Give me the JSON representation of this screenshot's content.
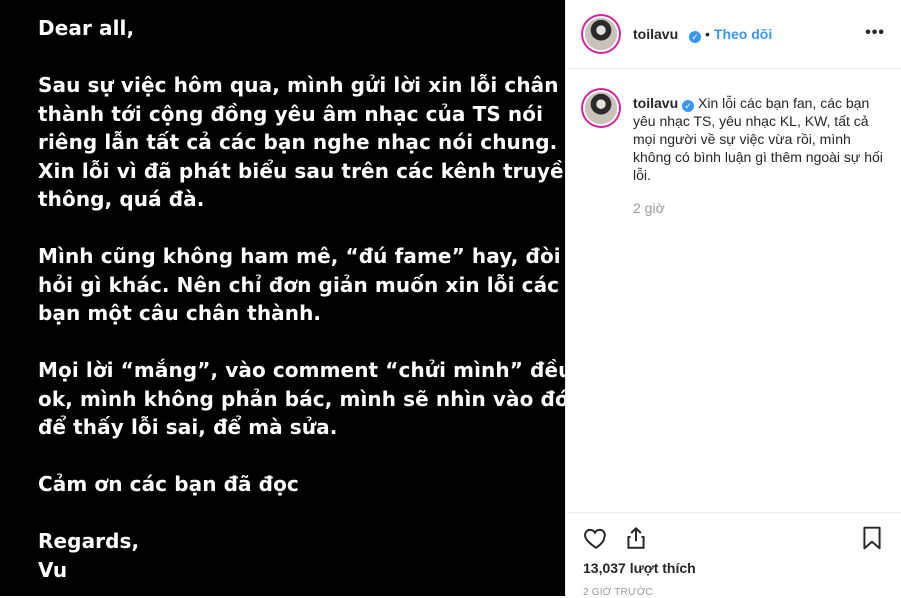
{
  "post_image": {
    "lines": [
      "Dear all,",
      "",
      "Sau sự việc hôm qua, mình gửi lời xin lỗi chân",
      "thành tới cộng đồng yêu âm nhạc của TS nói",
      "riêng lẫn tất cả các bạn nghe nhạc nói chung.",
      "Xin lỗi vì đã phát biểu sau trên các kênh truyền",
      "thông, quá đà.",
      "",
      "Mình cũng không ham mê, “đú fame” hay, đòi",
      "hỏi gì khác. Nên chỉ đơn giản muốn xin lỗi các",
      "bạn một câu chân thành.",
      "",
      "Mọi lời “mắng”, vào comment “chửi mình” đều",
      "ok, mình không phản bác, mình sẽ nhìn vào đó",
      "để thấy lỗi sai, để mà sửa.",
      "",
      "Cảm ơn các bạn đã đọc",
      "",
      "Regards,",
      "Vu"
    ]
  },
  "header": {
    "username": "toilavu",
    "separator": "•",
    "follow_label": "Theo dõi",
    "more_label": "•••"
  },
  "caption": {
    "username": "toilavu",
    "text": "Xin lỗi các bạn fan, các bạn yêu nhạc TS, yêu nhạc KL, KW, tất cả mọi người về sự việc vừa rồi, mình không có bình luận gì thêm ngoài sự hối lỗi.",
    "time": "2 giờ"
  },
  "footer": {
    "likes": "13,037 lượt thích",
    "posted": "2 GIỜ TRƯỚC"
  },
  "colors": {
    "accent": "#3897f0",
    "text": "#262626",
    "muted": "#999999"
  }
}
